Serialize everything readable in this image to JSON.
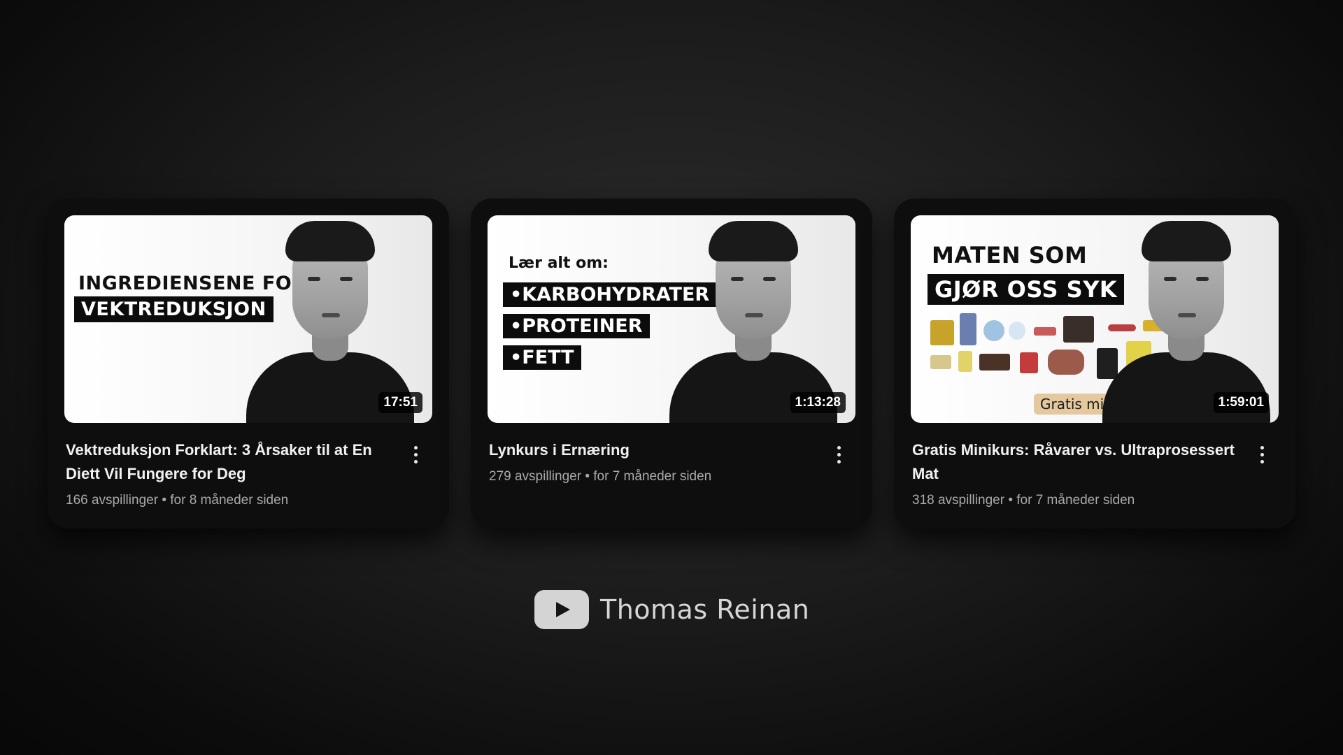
{
  "videos": [
    {
      "thumb_lines": [
        "INGREDIENSENE FOR",
        "VEKTREDUKSJON"
      ],
      "duration": "17:51",
      "title": "Vektreduksjon Forklart: 3 Årsaker til at En Diett Vil Fungere for Deg",
      "views": "166 avspillinger",
      "age": "for 8 måneder siden"
    },
    {
      "thumb_heading": "Lær alt om:",
      "thumb_bullets": [
        "•KARBOHYDRATER",
        "•PROTEINER",
        "•FETT"
      ],
      "duration": "1:13:28",
      "title": "Lynkurs i Ernæring",
      "views": "279 avspillinger",
      "age": "for 7 måneder siden"
    },
    {
      "thumb_lines": [
        "MATEN SOM",
        "GJØR OSS SYK"
      ],
      "thumb_badge": "Gratis minikurs",
      "duration": "1:59:01",
      "title": "Gratis Minikurs: Råvarer vs. Ultraprosessert Mat",
      "views": "318 avspillinger",
      "age": "for 7 måneder siden"
    }
  ],
  "meta_separator": "•",
  "channel": {
    "name": "Thomas Reinan",
    "logo_icon": "youtube-play-icon"
  },
  "colors": {
    "card_background": "#0e0e0e",
    "title_text": "#f1f1f1",
    "meta_text": "#aaaaaa",
    "badge_background": "#e4c89e"
  }
}
